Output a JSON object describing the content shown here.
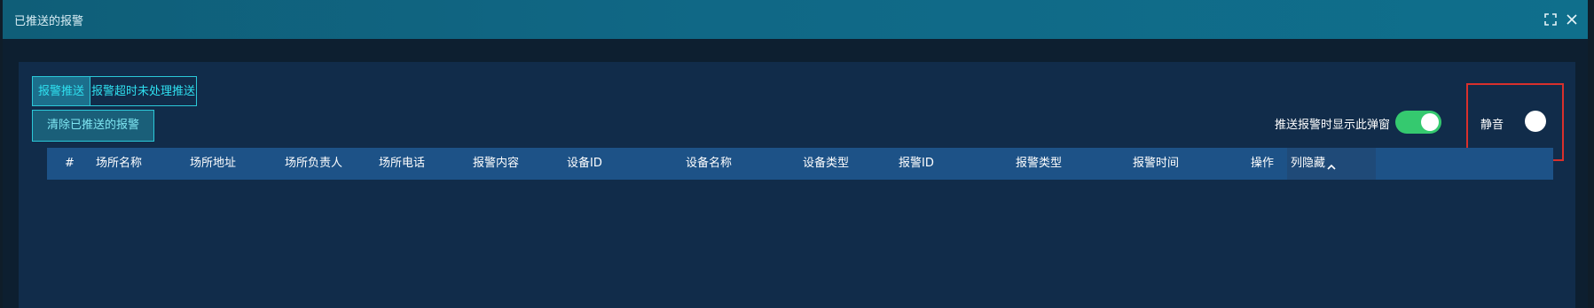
{
  "dialog": {
    "title": "已推送的报警",
    "icons": [
      "fullscreen-icon",
      "close-icon"
    ]
  },
  "tabs": [
    {
      "label": "报警推送",
      "active": true
    },
    {
      "label": "报警超时未处理推送",
      "active": false
    }
  ],
  "actions": {
    "clear_label": "清除已推送的报警"
  },
  "settings": {
    "popup_label": "推送报警时显示此弹窗",
    "popup_enabled": true,
    "mute_label": "静音",
    "mute_enabled": false
  },
  "table": {
    "columns": [
      "#",
      "场所名称",
      "场所地址",
      "场所负责人",
      "场所电话",
      "报警内容",
      "设备ID",
      "设备名称",
      "设备类型",
      "报警ID",
      "报警类型",
      "报警时间",
      "操作"
    ],
    "hide_columns_label": "列隐藏",
    "hide_columns_icon": "chevron-up-icon",
    "rows": []
  },
  "colors": {
    "titlebar": "#106886",
    "panel": "#112c4a",
    "accent": "#2fe0f0",
    "toggle_on": "#35c96f",
    "highlight_box": "#d9302c"
  }
}
